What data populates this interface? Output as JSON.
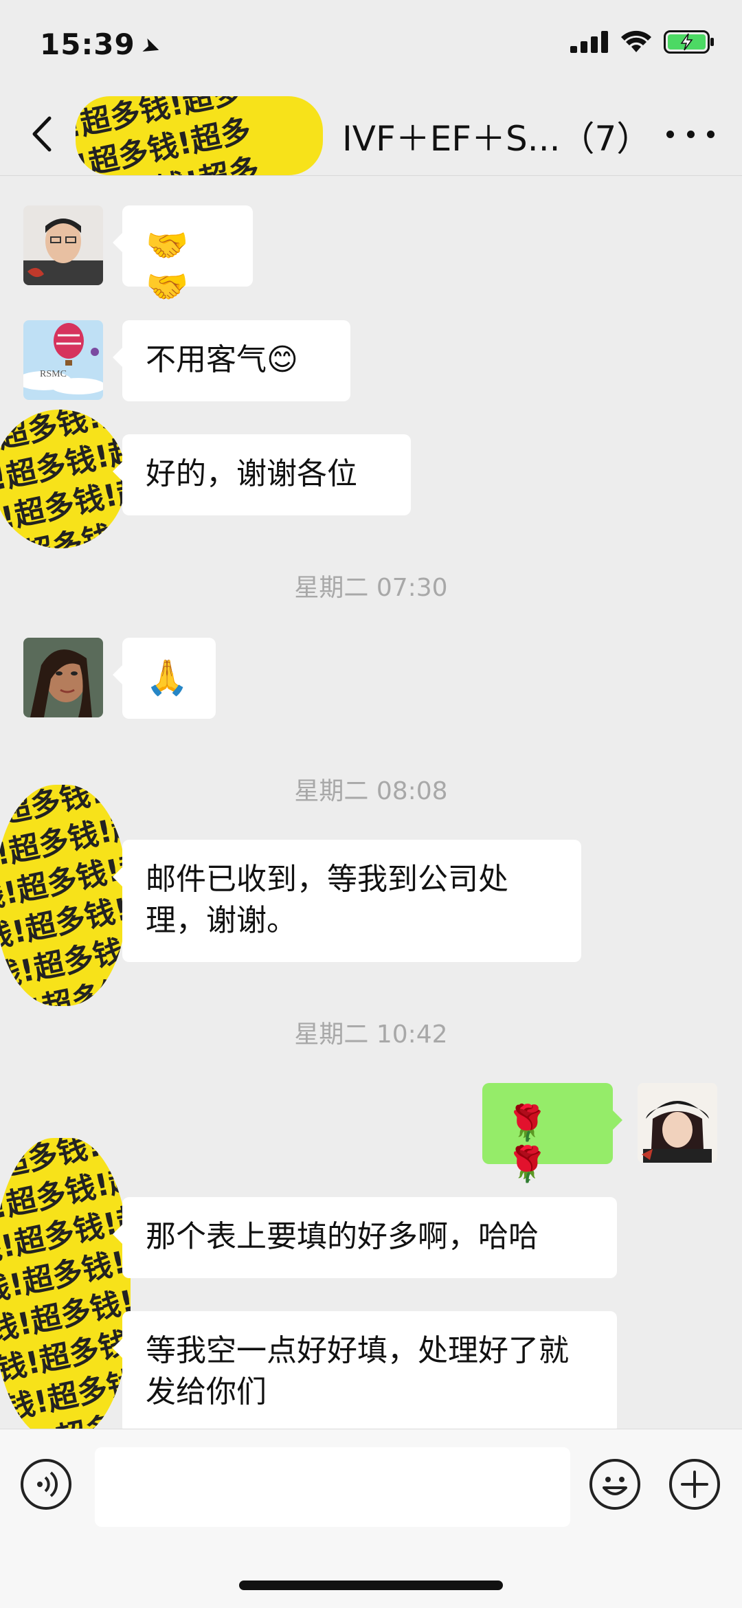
{
  "status_bar": {
    "time": "15:39",
    "location_icon": "location-arrow-icon",
    "signal_icon": "cellular-signal-icon",
    "wifi_icon": "wifi-icon",
    "battery_icon": "battery-charging-icon"
  },
  "header": {
    "title": "IVF＋EF＋S...（7）",
    "back_icon": "chevron-left-icon",
    "more_icon": "more-dots-icon"
  },
  "messages": [
    {
      "side": "left",
      "text": "🤝🤝"
    },
    {
      "side": "left",
      "text": "不用客气😊"
    },
    {
      "side": "left",
      "text": "好的，谢谢各位"
    },
    {
      "timestamp": "星期二 07:30"
    },
    {
      "side": "left",
      "text": "🙏"
    },
    {
      "timestamp": "星期二 08:08"
    },
    {
      "side": "left",
      "text": "邮件已收到，等我到公司处理，谢谢。"
    },
    {
      "timestamp": "星期二 10:42"
    },
    {
      "side": "right",
      "text": "🌹 🌹"
    },
    {
      "side": "left",
      "text": "那个表上要填的好多啊，哈哈"
    },
    {
      "side": "left",
      "text": "等我空一点好好填，处理好了就发给你们"
    }
  ],
  "composer": {
    "input_value": "",
    "voice_icon": "voice-icon",
    "emoji_icon": "emoji-icon",
    "plus_icon": "plus-circle-icon"
  },
  "sticker_text": "钱!超多钱!超多",
  "colors": {
    "background": "#ededed",
    "bubble_left": "#ffffff",
    "bubble_right": "#95ec69",
    "sticker": "#f7e21a"
  }
}
